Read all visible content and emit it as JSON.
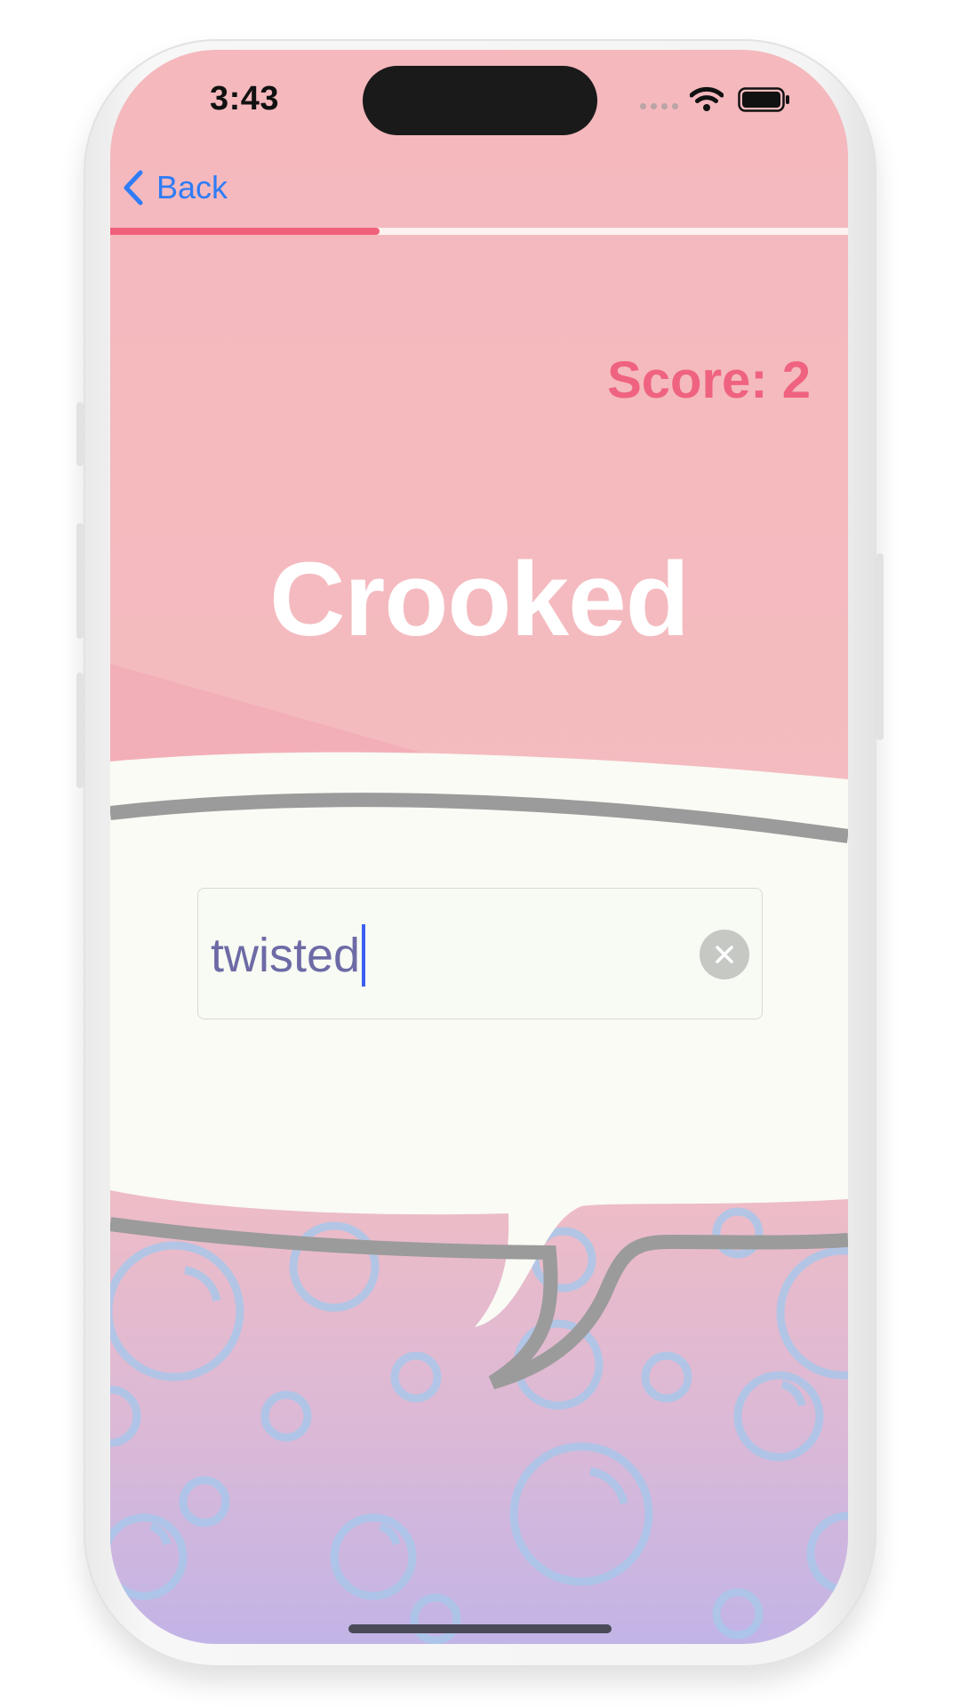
{
  "status_bar": {
    "time": "3:43",
    "icons": [
      "cellular-icon",
      "wifi-icon",
      "battery-icon"
    ]
  },
  "nav": {
    "back_label": "Back",
    "back_icon": "chevron-left-icon"
  },
  "progress": {
    "fraction": 0.365,
    "fill_color": "#f0607a",
    "track_color": "#fdf2ef"
  },
  "score": {
    "label": "Score: 2"
  },
  "prompt": {
    "word": "Crooked"
  },
  "answer": {
    "value": "twisted",
    "clear_icon": "clear-x-icon"
  },
  "colors": {
    "accent": "#ef6380",
    "link": "#2f7cf6",
    "bubble_fill": "#f7fbf3",
    "bubble_outline": "#9a9a9a",
    "bubbles": "#a9c7ea"
  }
}
